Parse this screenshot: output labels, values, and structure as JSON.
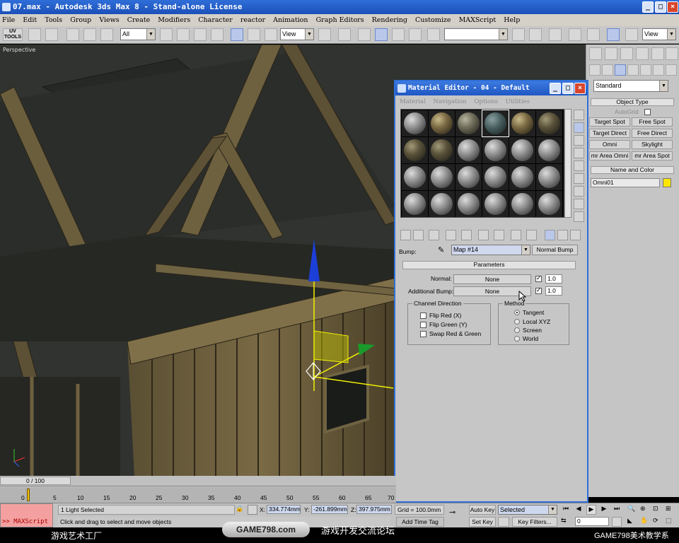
{
  "window": {
    "title": "07.max - Autodesk 3ds Max 8 - Stand-alone License"
  },
  "menu": [
    "File",
    "Edit",
    "Tools",
    "Group",
    "Views",
    "Create",
    "Modifiers",
    "Character",
    "reactor",
    "Animation",
    "Graph Editors",
    "Rendering",
    "Customize",
    "MAXScript",
    "Help"
  ],
  "toolbar": {
    "uv_tools": "UV TOOLS",
    "selection_filter": "All",
    "ref_coord": "View",
    "named_sel": "",
    "view_right": "View"
  },
  "viewport": {
    "label": "Perspective"
  },
  "command_panel": {
    "category": "Standard",
    "object_type_title": "Object Type",
    "autogrid": "AutoGrid",
    "buttons": [
      "Target Spot",
      "Free Spot",
      "Target Direct",
      "Free Direct",
      "Omni",
      "Skylight",
      "mr Area Omni",
      "mr Area Spot"
    ],
    "name_color_title": "Name and Color",
    "object_name": "Omni01",
    "object_color": "#ffe600"
  },
  "material_editor": {
    "title": "Material Editor - 04 - Default",
    "menu": [
      "Material",
      "Navigation",
      "Options",
      "Utilities"
    ],
    "bump_label": "Bump:",
    "bump_map": "Map #14",
    "bump_type": "Normal Bump",
    "params_title": "Parameters",
    "normal_label": "Normal:",
    "normal_map": "None",
    "normal_amount": "1.0",
    "add_bump_label": "Additional Bump:",
    "add_bump_map": "None",
    "add_bump_amount": "1.0",
    "channel_title": "Channel Direction",
    "channels": [
      "Flip Red (X)",
      "Flip Green (Y)",
      "Swap Red & Green"
    ],
    "method_title": "Method",
    "methods": [
      "Tangent",
      "Local XYZ",
      "Screen",
      "World"
    ],
    "method_selected": "Tangent"
  },
  "timeline": {
    "frame": "0 / 100",
    "ticks": [
      "0",
      "5",
      "10",
      "15",
      "20",
      "25",
      "30",
      "35",
      "40",
      "45",
      "50",
      "55",
      "60",
      "65",
      "70"
    ]
  },
  "status": {
    "maxscript": ">> MAXScript",
    "selected": "1 Light Selected",
    "prompt": "Click and drag to select and move objects",
    "x_label": "X:",
    "x": "334.774mm",
    "y_label": "Y:",
    "y": "-261.899mm",
    "z_label": "Z:",
    "z": "397.975mm",
    "grid": "Grid = 100.0mm",
    "add_time_tag": "Add Time Tag",
    "auto_key": "Auto Key",
    "set_key": "Set Key",
    "key_mode": "Selected",
    "key_filters": "Key Filters...",
    "current_frame": "0"
  },
  "footer": {
    "left": "游戏艺术工厂",
    "logo": "GAME798.com",
    "middle": "游戏开发交流论坛",
    "right": "GAME798美术教学系"
  }
}
